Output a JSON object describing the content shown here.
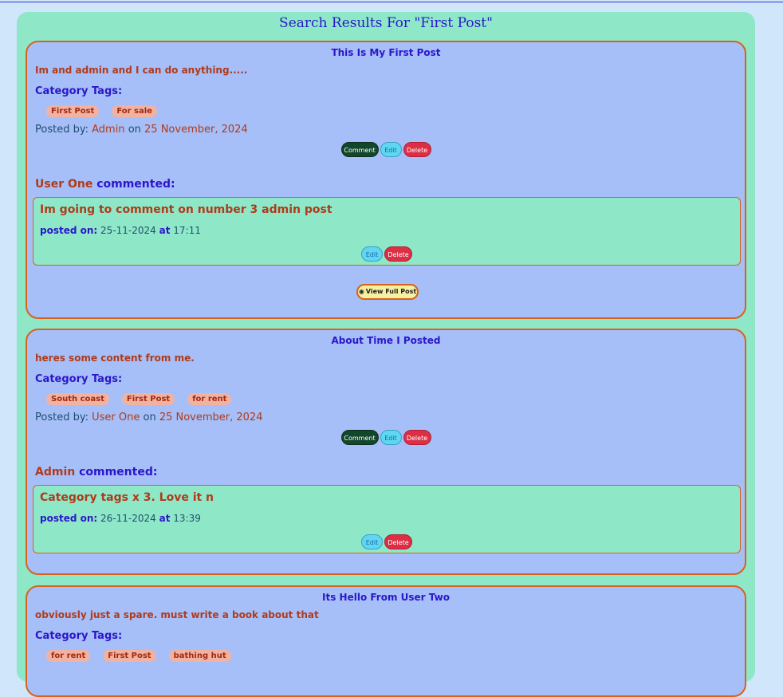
{
  "page": {
    "heading": "Search Results For \"First Post\""
  },
  "posts": [
    {
      "title": "This Is My First Post",
      "content": "Im and admin and I can do anything.....",
      "tags_label": "Category Tags:",
      "tags": [
        "First Post",
        "For sale"
      ],
      "posted_by_label": "Posted by:",
      "author": "Admin",
      "on_label": "on",
      "date": "25 November, 2024",
      "buttons": {
        "comment": "Comment",
        "edit": "Edit",
        "delete": "Delete"
      },
      "comment": {
        "author": "User One",
        "verb": "commented:",
        "text": "Im going to comment on number 3 admin post",
        "posted_on_label": "posted on:",
        "date": "25-11-2024",
        "at_label": "at",
        "time": "17:11",
        "edit": "Edit",
        "delete": "Delete"
      },
      "view_full": "View Full Post"
    },
    {
      "title": "About Time I Posted",
      "content": "heres some content from me.",
      "tags_label": "Category Tags:",
      "tags": [
        "South coast",
        "First Post",
        "for rent"
      ],
      "posted_by_label": "Posted by:",
      "author": "User One",
      "on_label": "on",
      "date": "25 November, 2024",
      "buttons": {
        "comment": "Comment",
        "edit": "Edit",
        "delete": "Delete"
      },
      "comment": {
        "author": "Admin",
        "verb": "commented:",
        "text": "Category tags x 3. Love it n",
        "posted_on_label": "posted on:",
        "date": "26-11-2024",
        "at_label": "at",
        "time": "13:39",
        "edit": "Edit",
        "delete": "Delete"
      }
    },
    {
      "title": "Its Hello From User Two",
      "content": "obviously just a spare. must write a book about that",
      "tags_label": "Category Tags:",
      "tags": [
        "for rent",
        "First Post",
        "bathing hut"
      ]
    }
  ],
  "icons": {
    "view": "eye-icon"
  },
  "colors": {
    "page_bg": "#cfe6fb",
    "results_bg": "#8ee8c8",
    "post_bg": "#a6bff8",
    "post_border": "#d7621b",
    "title_color": "#2b16c9",
    "content_color": "#b03a1a",
    "comment_btn": "#12472b",
    "edit_btn": "#5ed8f2",
    "delete_btn": "#dc2f45",
    "view_btn": "#f6f0a0"
  }
}
